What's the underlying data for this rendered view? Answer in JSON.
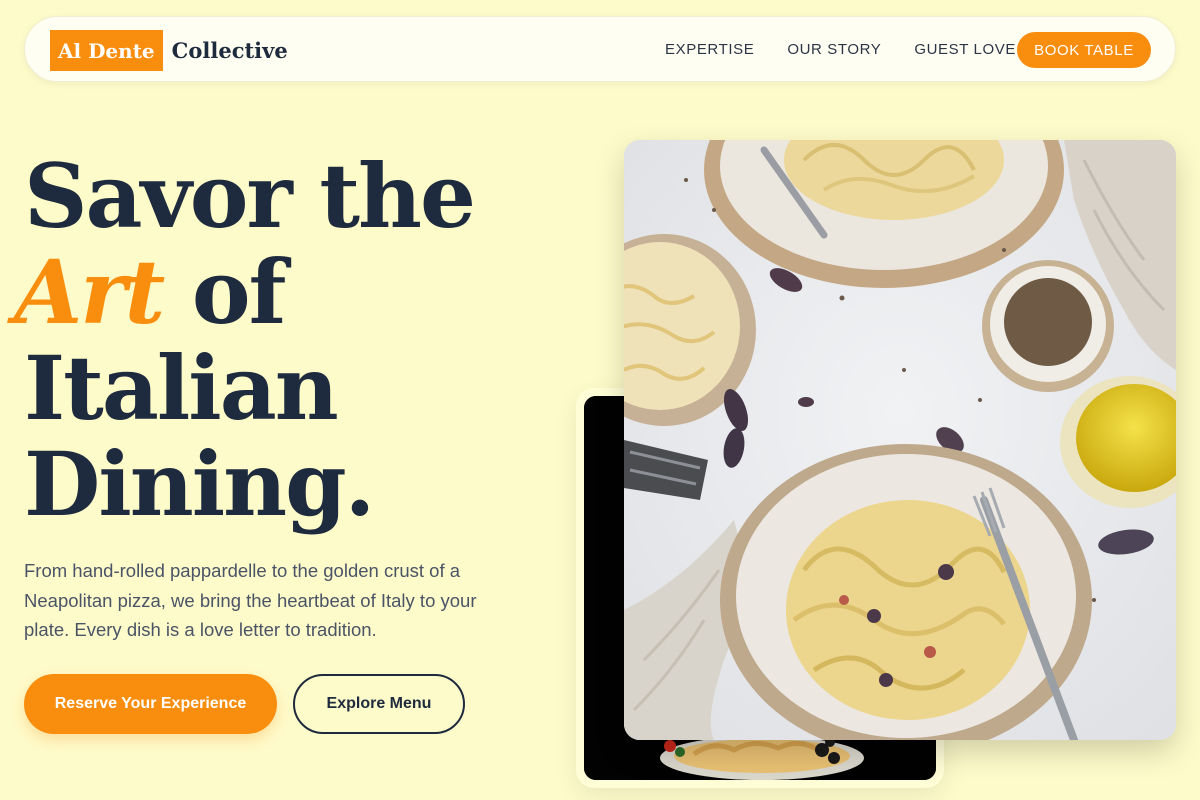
{
  "brand": {
    "badge": "Al Dente",
    "name": "Collective"
  },
  "nav": {
    "links": [
      "EXPERTISE",
      "OUR STORY",
      "GUEST LOVE"
    ],
    "cta": "BOOK TABLE"
  },
  "hero": {
    "headline_line1": "Savor the",
    "headline_accent": "Art",
    "headline_line2_rest": " of",
    "headline_line3": "Italian",
    "headline_line4": "Dining.",
    "lead": "From hand-rolled pappardelle to the golden crust of a Neapolitan pizza, we bring the heartbeat of Italy to your plate. Every dish is a love letter to tradition.",
    "primary_button": "Reserve Your Experience",
    "secondary_button": "Explore Menu"
  },
  "colors": {
    "background": "#fefbca",
    "accent": "#f98d0e",
    "navy": "#1e2a3d"
  }
}
